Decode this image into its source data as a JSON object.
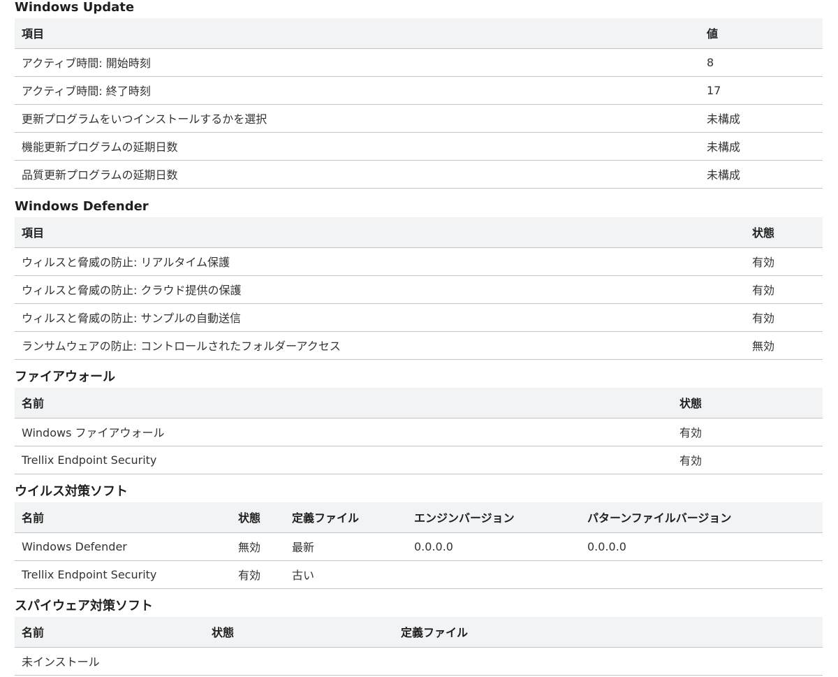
{
  "windows_update": {
    "title": "Windows Update",
    "headers": [
      "項目",
      "値"
    ],
    "rows": [
      [
        "アクティブ時間: 開始時刻",
        "8"
      ],
      [
        "アクティブ時間: 終了時刻",
        "17"
      ],
      [
        "更新プログラムをいつインストールするかを選択",
        "未構成"
      ],
      [
        "機能更新プログラムの延期日数",
        "未構成"
      ],
      [
        "品質更新プログラムの延期日数",
        "未構成"
      ]
    ]
  },
  "windows_defender": {
    "title": "Windows Defender",
    "headers": [
      "項目",
      "状態"
    ],
    "rows": [
      [
        "ウィルスと脅威の防止: リアルタイム保護",
        "有効"
      ],
      [
        "ウィルスと脅威の防止: クラウド提供の保護",
        "有効"
      ],
      [
        "ウィルスと脅威の防止: サンプルの自動送信",
        "有効"
      ],
      [
        "ランサムウェアの防止: コントロールされたフォルダーアクセス",
        "無効"
      ]
    ]
  },
  "firewall": {
    "title": "ファイアウォール",
    "headers": [
      "名前",
      "状態"
    ],
    "rows": [
      [
        "Windows ファイアウォール",
        "有効"
      ],
      [
        "Trellix Endpoint Security",
        "有効"
      ]
    ]
  },
  "antivirus": {
    "title": "ウイルス対策ソフト",
    "headers": [
      "名前",
      "状態",
      "定義ファイル",
      "エンジンバージョン",
      "パターンファイルバージョン"
    ],
    "rows": [
      [
        "Windows Defender",
        "無効",
        "最新",
        "0.0.0.0",
        "0.0.0.0"
      ],
      [
        "Trellix Endpoint Security",
        "有効",
        "古い",
        "",
        ""
      ]
    ]
  },
  "antispyware": {
    "title": "スパイウェア対策ソフト",
    "headers": [
      "名前",
      "状態",
      "定義ファイル"
    ],
    "rows": [
      [
        "未インストール",
        "",
        ""
      ]
    ]
  }
}
